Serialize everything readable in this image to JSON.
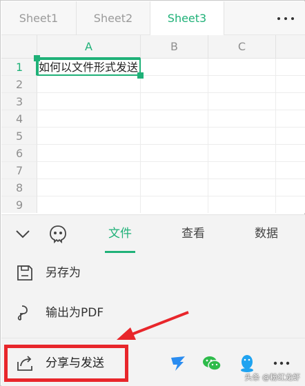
{
  "sheet_tabs": [
    "Sheet1",
    "Sheet2",
    "Sheet3"
  ],
  "active_sheet": "Sheet3",
  "grid": {
    "columns": [
      "A",
      "B",
      "C"
    ],
    "rows": [
      "1",
      "2",
      "3",
      "4",
      "5",
      "6",
      "7",
      "8",
      "9"
    ],
    "selected_column": "A",
    "selected_row": "1",
    "cell_a1": "如何以文件形式发送"
  },
  "panel": {
    "tabs": [
      "文件",
      "查看",
      "数据"
    ],
    "active_tab": "文件",
    "menu": {
      "save_as": "另存为",
      "export_pdf": "输出为PDF",
      "share_send": "分享与发送"
    },
    "share_apps": [
      "dingtalk-icon",
      "wechat-icon",
      "qq-icon",
      "more-icon"
    ]
  },
  "colors": {
    "accent": "#1fb178",
    "highlight": "#e8262b"
  },
  "watermark": "头条 @粉红龙虾"
}
